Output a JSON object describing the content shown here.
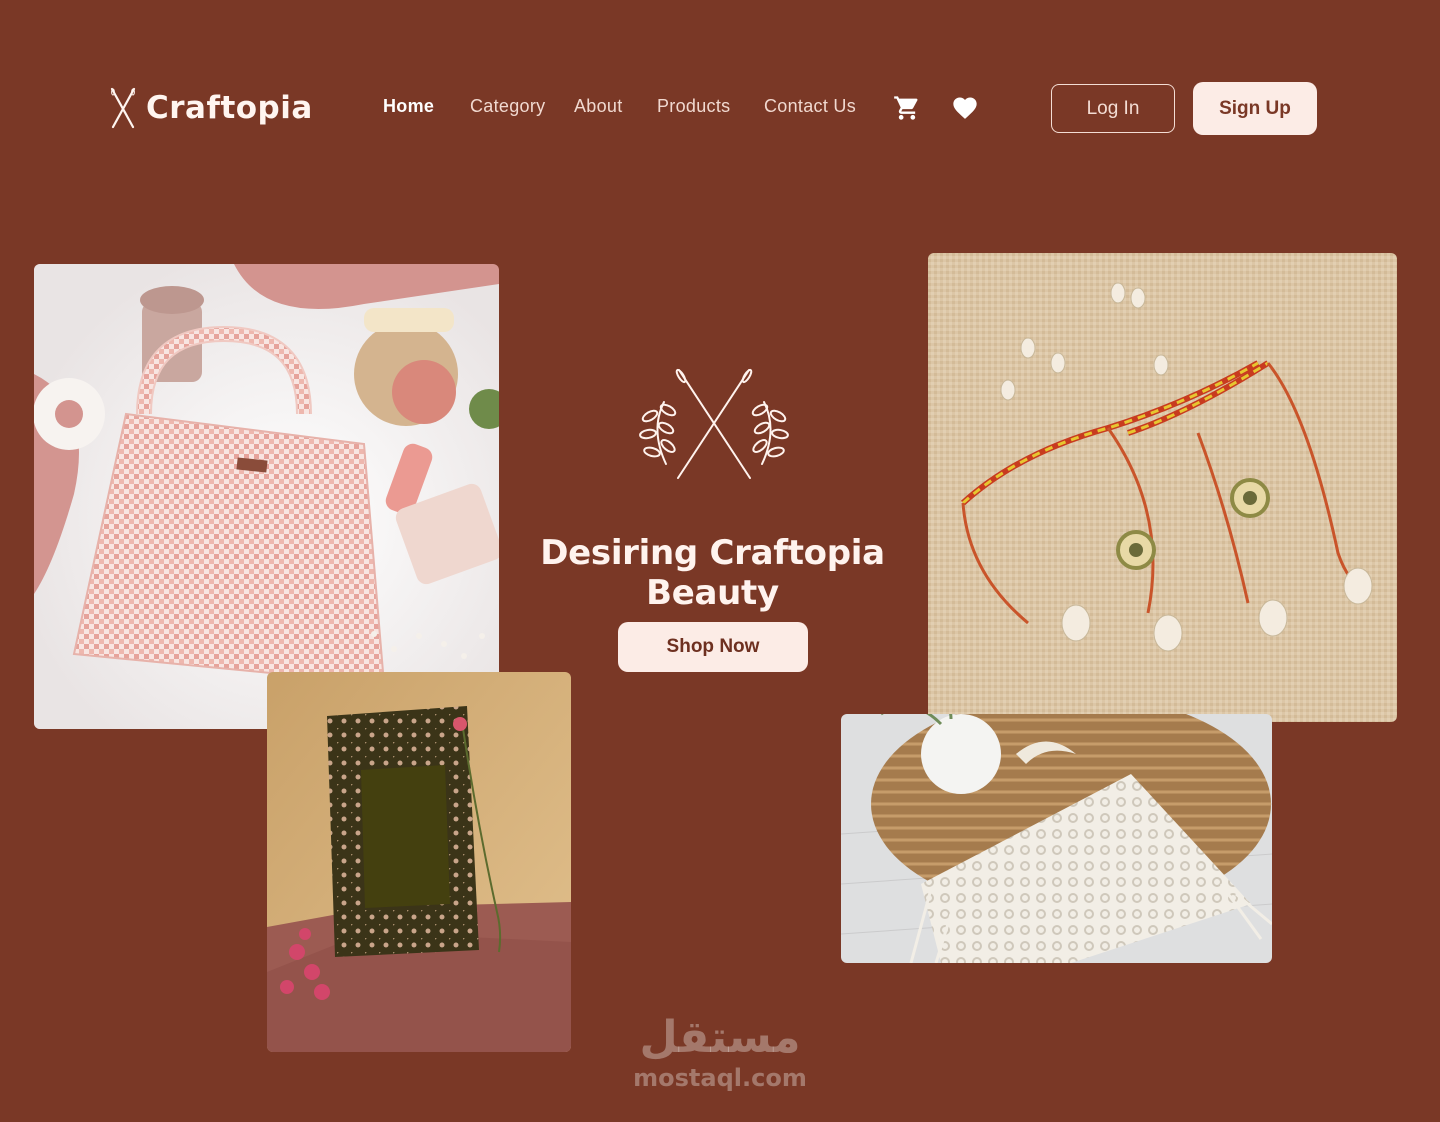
{
  "brand": {
    "name": "Craftopia",
    "logo_icon": "crossed-needles-icon"
  },
  "nav": {
    "items": [
      {
        "label": "Home",
        "active": true
      },
      {
        "label": "Category",
        "active": false
      },
      {
        "label": "About",
        "active": false
      },
      {
        "label": "Products",
        "active": false
      },
      {
        "label": "Contact  Us",
        "active": false
      }
    ],
    "icons": [
      "cart-icon",
      "heart-icon"
    ]
  },
  "auth": {
    "login_label": "Log In",
    "signup_label": "Sign Up"
  },
  "hero": {
    "emblem_icon": "crossed-needles-laurel-icon",
    "tagline": "Desiring Craftopia Beauty",
    "cta_label": "Shop Now"
  },
  "watermark": {
    "arabic": "مستقل",
    "latin": "mostaql.com"
  },
  "colors": {
    "background": "#7a3826",
    "button_light": "#fcece6",
    "text_light": "#fff3ee"
  }
}
